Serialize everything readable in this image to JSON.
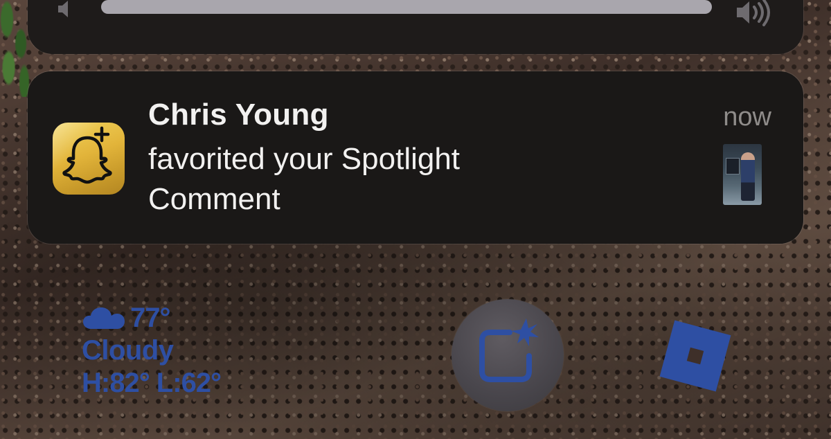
{
  "volume": {
    "low_icon": "speaker-low-icon",
    "high_icon": "speaker-high-icon",
    "level": 1.0
  },
  "notification": {
    "app_icon": "snapchat-plus-icon",
    "title": "Chris Young",
    "message": "favorited your Spotlight Comment",
    "time": "now",
    "thumbnail": "spotlight-thumbnail"
  },
  "weather": {
    "icon": "cloud-icon",
    "temperature": "77°",
    "condition": "Cloudy",
    "high_low": "H:82° L:62°"
  },
  "lockscreen_shortcuts": [
    {
      "icon": "sparkle-frame-icon"
    },
    {
      "icon": "roblox-icon"
    }
  ],
  "colors": {
    "widget_blue": "#2e4fa3",
    "panel_bg": "#1a1817",
    "snapchat_gold": "#e2b43a"
  }
}
